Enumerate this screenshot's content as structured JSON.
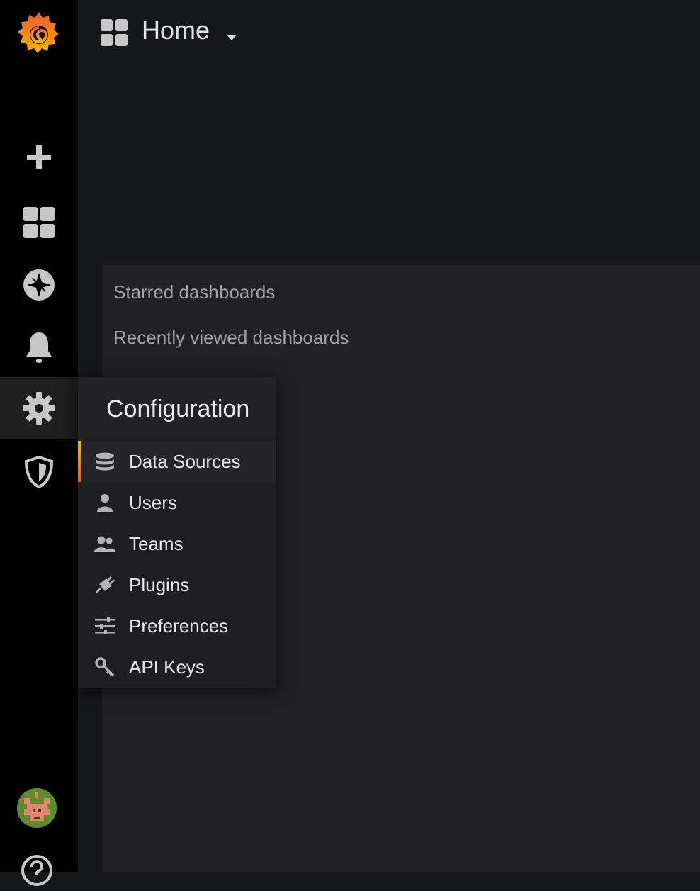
{
  "header": {
    "title": "Home"
  },
  "sidebar": {
    "items": [
      {
        "name": "create",
        "icon": "plus-icon"
      },
      {
        "name": "dashboards",
        "icon": "dashboards-grid-icon"
      },
      {
        "name": "explore",
        "icon": "compass-icon"
      },
      {
        "name": "alerting",
        "icon": "bell-icon"
      },
      {
        "name": "configuration",
        "icon": "gear-icon",
        "active": true
      },
      {
        "name": "server-admin",
        "icon": "shield-icon"
      }
    ]
  },
  "panel": {
    "starred": "Starred dashboards",
    "recent": "Recently viewed dashboards"
  },
  "config_menu": {
    "title": "Configuration",
    "items": [
      {
        "label": "Data Sources",
        "icon": "database-icon",
        "active": true
      },
      {
        "label": "Users",
        "icon": "user-icon"
      },
      {
        "label": "Teams",
        "icon": "users-icon"
      },
      {
        "label": "Plugins",
        "icon": "plug-icon"
      },
      {
        "label": "Preferences",
        "icon": "sliders-icon"
      },
      {
        "label": "API Keys",
        "icon": "key-icon"
      }
    ]
  },
  "colors": {
    "accent": "#ef5b21",
    "accent_secondary": "#fbb500",
    "sidebar_bg": "#000000",
    "page_bg": "#161719"
  }
}
